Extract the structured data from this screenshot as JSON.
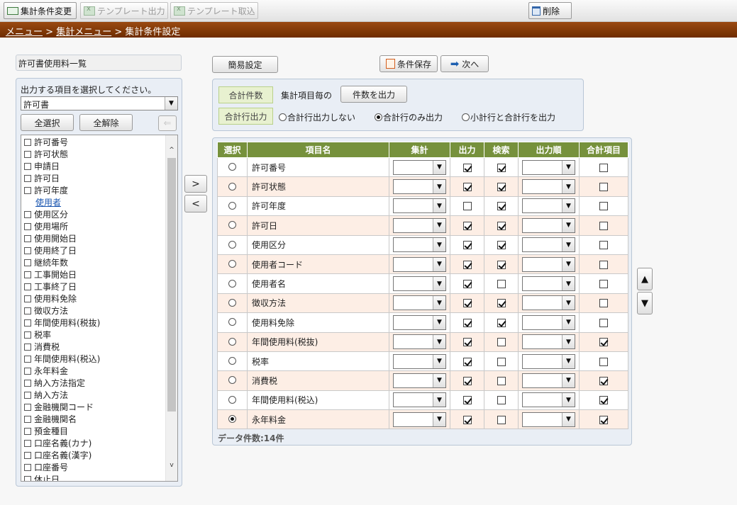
{
  "toolbar": {
    "change_label": "集計条件変更",
    "template_out_label": "テンプレート出力",
    "template_in_label": "テンプレート取込",
    "delete_label": "削除"
  },
  "breadcrumb": {
    "menu": "メニュー",
    "sep1": ">",
    "sum_menu": "集計メニュー",
    "sep2": ">",
    "current": "集計条件設定"
  },
  "left_panel": {
    "title": "許可書使用料一覧",
    "prompt": "出力する項目を選択してください。",
    "selected": "許可書",
    "select_all": "全選択",
    "deselect_all": "全解除",
    "back_icon": "⇐",
    "fields": [
      {
        "label": "許可番号",
        "type": "check"
      },
      {
        "label": "許可状態",
        "type": "check"
      },
      {
        "label": "申請日",
        "type": "check"
      },
      {
        "label": "許可日",
        "type": "check"
      },
      {
        "label": "許可年度",
        "type": "check"
      },
      {
        "label": "使用者",
        "type": "link"
      },
      {
        "label": "使用区分",
        "type": "check"
      },
      {
        "label": "使用場所",
        "type": "check"
      },
      {
        "label": "使用開始日",
        "type": "check"
      },
      {
        "label": "使用終了日",
        "type": "check"
      },
      {
        "label": "継続年数",
        "type": "check"
      },
      {
        "label": "工事開始日",
        "type": "check"
      },
      {
        "label": "工事終了日",
        "type": "check"
      },
      {
        "label": "使用料免除",
        "type": "check"
      },
      {
        "label": "徴収方法",
        "type": "check"
      },
      {
        "label": "年間使用料(税抜)",
        "type": "check"
      },
      {
        "label": "税率",
        "type": "check"
      },
      {
        "label": "消費税",
        "type": "check"
      },
      {
        "label": "年間使用料(税込)",
        "type": "check"
      },
      {
        "label": "永年料金",
        "type": "check"
      },
      {
        "label": "納入方法指定",
        "type": "check"
      },
      {
        "label": "納入方法",
        "type": "check"
      },
      {
        "label": "金融機関コード",
        "type": "check"
      },
      {
        "label": "金融機関名",
        "type": "check"
      },
      {
        "label": "預金種目",
        "type": "check"
      },
      {
        "label": "口座名義(カナ)",
        "type": "check"
      },
      {
        "label": "口座名義(漢字)",
        "type": "check"
      },
      {
        "label": "口座番号",
        "type": "check"
      },
      {
        "label": "休止日",
        "type": "check"
      }
    ]
  },
  "arrows": {
    "add": ">",
    "remove": "<"
  },
  "actions": {
    "simple": "簡易設定",
    "save": "条件保存",
    "next": "次へ"
  },
  "options": {
    "total_count_label": "合計件数",
    "per_item_text": "集計項目毎の",
    "count_output_button": "件数を出力",
    "total_row_label": "合計行出力",
    "radio_none": "合計行出力しない",
    "radio_total_only": "合計行のみ出力",
    "radio_sub_total": "小計行と合計行を出力",
    "selected_radio": "total_only"
  },
  "table": {
    "headers": [
      "選択",
      "項目名",
      "集計",
      "出力",
      "検索",
      "出力順",
      "合計項目"
    ],
    "rows": [
      {
        "name": "許可番号",
        "selected": false,
        "output": true,
        "search": true,
        "total": false
      },
      {
        "name": "許可状態",
        "selected": false,
        "output": true,
        "search": true,
        "total": false
      },
      {
        "name": "許可年度",
        "selected": false,
        "output": false,
        "search": true,
        "total": false
      },
      {
        "name": "許可日",
        "selected": false,
        "output": true,
        "search": true,
        "total": false
      },
      {
        "name": "使用区分",
        "selected": false,
        "output": true,
        "search": true,
        "total": false
      },
      {
        "name": "使用者コード",
        "selected": false,
        "output": true,
        "search": true,
        "total": false
      },
      {
        "name": "使用者名",
        "selected": false,
        "output": true,
        "search": false,
        "total": false
      },
      {
        "name": "徴収方法",
        "selected": false,
        "output": true,
        "search": true,
        "total": false
      },
      {
        "name": "使用料免除",
        "selected": false,
        "output": true,
        "search": true,
        "total": false
      },
      {
        "name": "年間使用料(税抜)",
        "selected": false,
        "output": true,
        "search": false,
        "total": true
      },
      {
        "name": "税率",
        "selected": false,
        "output": true,
        "search": false,
        "total": false
      },
      {
        "name": "消費税",
        "selected": false,
        "output": true,
        "search": false,
        "total": true
      },
      {
        "name": "年間使用料(税込)",
        "selected": false,
        "output": true,
        "search": false,
        "total": true
      },
      {
        "name": "永年料金",
        "selected": true,
        "output": true,
        "search": false,
        "total": true
      }
    ],
    "count": "データ件数:14件"
  },
  "move": {
    "up": "▲",
    "down": "▼"
  },
  "colors": {
    "header_green": "#76913c",
    "breadcrumb_brown": "#7d3303",
    "alt_row": "#fdeee5"
  }
}
